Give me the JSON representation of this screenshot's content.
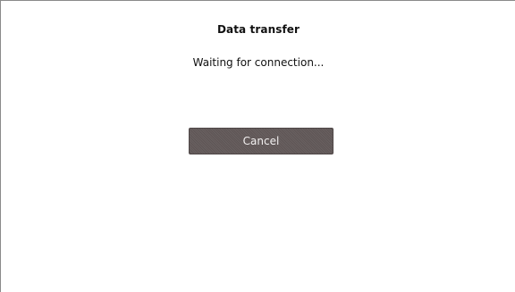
{
  "dialog": {
    "title": "Data transfer",
    "status": "Waiting for connection...",
    "cancel_label": "Cancel"
  },
  "colors": {
    "button_background": "#615858",
    "button_text": "#f2f0f0",
    "border": "#8a8a8a"
  }
}
